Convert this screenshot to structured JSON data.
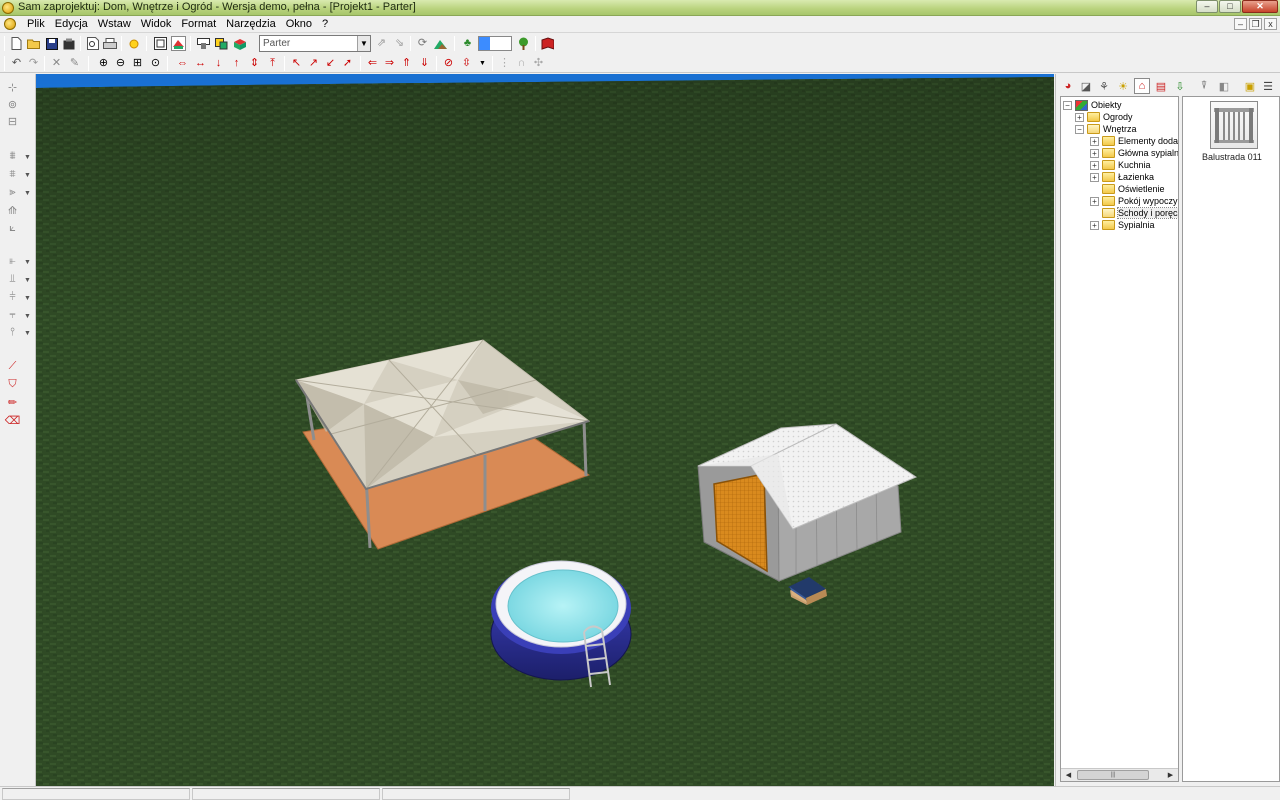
{
  "window": {
    "title": "Sam zaprojektuj: Dom, Wnętrze i Ogród  -  Wersja demo, pełna - [Projekt1 - Parter]",
    "buttons": {
      "minimize": "–",
      "maximize": "□",
      "close": "✕"
    }
  },
  "menu": {
    "items": [
      "Plik",
      "Edycja",
      "Wstaw",
      "Widok",
      "Format",
      "Narzędzia",
      "Okno",
      "?"
    ]
  },
  "mdi": {
    "minimize": "–",
    "restore": "❐",
    "close": "x"
  },
  "toolbar": {
    "floor_select_value": "Parter"
  },
  "tree": {
    "root": "Obiekty",
    "nodes": [
      {
        "label": "Ogrody",
        "expander": "+",
        "level": 1
      },
      {
        "label": "Wnętrza",
        "expander": "−",
        "level": 1
      },
      {
        "label": "Elementy dodatk",
        "expander": "+",
        "level": 2
      },
      {
        "label": "Główna sypialni",
        "expander": "+",
        "level": 2
      },
      {
        "label": "Kuchnia",
        "expander": "+",
        "level": 2
      },
      {
        "label": "Łazienka",
        "expander": "+",
        "level": 2
      },
      {
        "label": "Oświetlenie",
        "expander": "",
        "level": 2
      },
      {
        "label": "Pokój wypoczyn",
        "expander": "+",
        "level": 2
      },
      {
        "label": "Schody i poręcz",
        "expander": "",
        "level": 2,
        "selected": true
      },
      {
        "label": "Sypialnia",
        "expander": "+",
        "level": 2
      }
    ],
    "scroll_thumb": "|||"
  },
  "preview": {
    "item_label": "Balustrada 011"
  },
  "colors": {
    "titlebar": "#b8d27c",
    "grass": "#2f4a25",
    "sky": "#1e88ff",
    "paving": "#d98a55",
    "canopy": "#d9d4c5",
    "pool_water": "#9fe8ef",
    "pool_ring": "#2c2f9a",
    "shed_door": "#d98a1e"
  },
  "icons": {
    "app": "house-globe-icon",
    "floor_dropdown": "chevron-down-icon"
  }
}
